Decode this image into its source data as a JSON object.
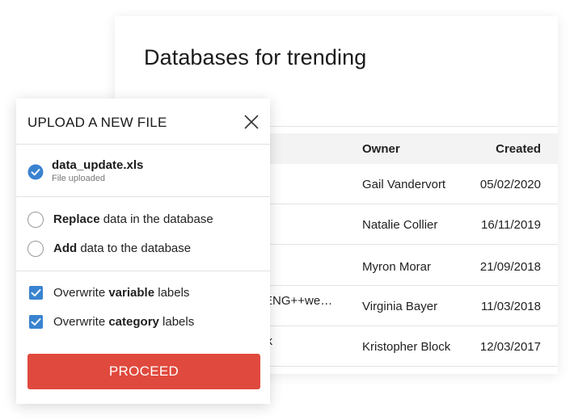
{
  "background_page": {
    "title": "Databases for trending",
    "table": {
      "headers": {
        "owner": "Owner",
        "created": "Created"
      },
      "rows": [
        {
          "name": "",
          "owner": "Gail Vandervort",
          "created": "05/02/2020"
        },
        {
          "name": "",
          "owner": "Natalie Collier",
          "created": "16/11/2019"
        },
        {
          "name": "",
          "owner": "Myron Morar",
          "created": "21/09/2018"
        },
        {
          "name": "-ENG++we…",
          "owner": "Virginia Bayer",
          "created": "11/03/2018"
        },
        {
          "name": "ck",
          "owner": "Kristopher Block",
          "created": "12/03/2017"
        }
      ]
    }
  },
  "modal": {
    "title": "UPLOAD A NEW FILE",
    "close_icon": "close-icon",
    "file": {
      "name": "data_update.xls",
      "status": "File uploaded",
      "icon": "check-circle-icon"
    },
    "radio_options": [
      {
        "bold": "Replace",
        "rest": " data in the database",
        "selected": false
      },
      {
        "bold": "Add",
        "rest": " data to the database",
        "selected": false
      }
    ],
    "checkboxes": [
      {
        "prefix": "Overwrite ",
        "bold": "variable",
        "suffix": " labels",
        "checked": true
      },
      {
        "prefix": "Overwrite ",
        "bold": "category",
        "suffix": " labels",
        "checked": true
      }
    ],
    "proceed_label": "PROCEED"
  },
  "colors": {
    "accent_blue": "#3a83d0",
    "proceed_red": "#e0493d",
    "header_bg": "#f3f3f3"
  }
}
